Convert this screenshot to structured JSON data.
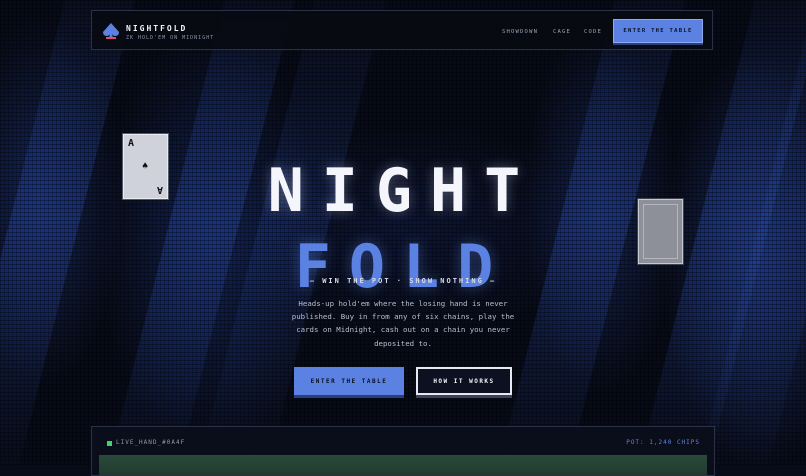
{
  "nav": {
    "brand": "NIGHTFOLD",
    "tagline": "ZK HOLD'EM ON MIDNIGHT",
    "links": [
      "SHOWDOWN",
      "CAGE",
      "CODE"
    ],
    "cta": "ENTER THE TABLE"
  },
  "hero": {
    "title_line1": "NIGHT",
    "title_line2": "FOLD",
    "kicker": "— WIN THE POT · SHOW NOTHING —",
    "description": "Heads-up hold'em where the losing hand is never published. Buy in from any of six chains, play the cards on Midnight, cash out on a chain you never deposited to.",
    "primary_button": "ENTER THE TABLE",
    "secondary_button": "HOW IT WORKS"
  },
  "cards": {
    "ace_rank": "A",
    "ace_suit": "♠"
  },
  "live_panel": {
    "label": "LIVE_HAND_#0A4F",
    "pot": "POT: 1,240 CHIPS"
  },
  "colors": {
    "accent": "#5b82e3",
    "background": "#070b18",
    "live_indicator": "#47d16a"
  },
  "icons": [
    "spade-logo-icon",
    "live-dot-icon"
  ]
}
